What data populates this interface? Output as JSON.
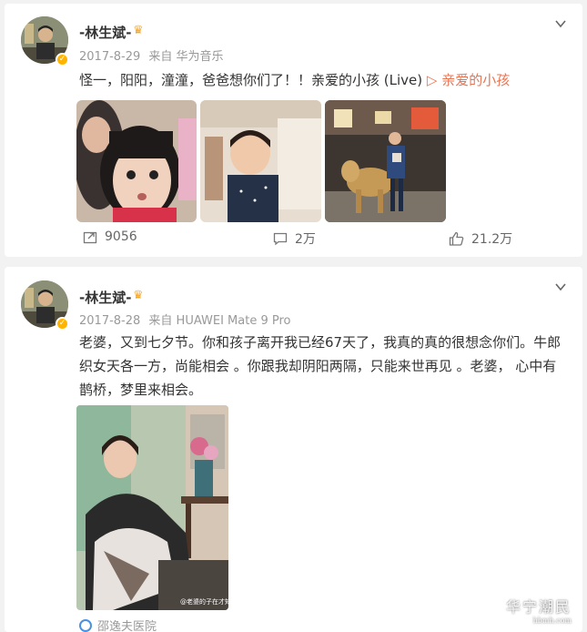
{
  "posts": [
    {
      "author": "-林生斌-",
      "date": "2017-8-29",
      "source": "来自 华为音乐",
      "text": "怪一，阳阳，潼潼，爸爸想你们了！！亲爱的小孩 (Live)",
      "music_link": "▷ 亲爱的小孩",
      "images": [
        "mother-daughter-selfie",
        "toddler-boy-photo",
        "boy-with-pig-statue"
      ],
      "reposts": "9056",
      "comments": "2万",
      "likes": "21.2万"
    },
    {
      "author": "-林生斌-",
      "date": "2017-8-28",
      "source": "来自 HUAWEI Mate 9 Pro",
      "text_line1": "老婆，又到七夕节。你和孩子离开我已经67天了，我真的真的很想念你们。牛郎",
      "text_line2": "织女天各一方，尚能相会 。你跟我却阴阳两隔，只能来世再见 。老婆， 心中有",
      "text_line3": "鹊桥，梦里来相会。",
      "images": [
        "woman-seated-photo"
      ],
      "photo_watermark": "@老婆的子在才知",
      "location_chip": "邵逸夫医院"
    }
  ],
  "watermark": {
    "main": "华宁潮民",
    "sub": "hbmh.com"
  },
  "colors": {
    "link": "#eb7350",
    "badge": "#ffb400",
    "meta": "#999999"
  }
}
